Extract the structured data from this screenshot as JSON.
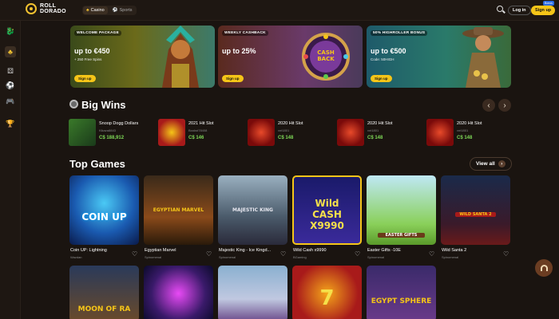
{
  "header": {
    "logo_line1": "ROLL",
    "logo_line2": "DORADO",
    "tabs": [
      {
        "label": "Casino",
        "icon": "casino-icon",
        "active": true
      },
      {
        "label": "Sports",
        "icon": "sports-icon",
        "active": false
      }
    ],
    "login_label": "Log in",
    "signup_label": "Sign up",
    "signup_badge": "Bonus"
  },
  "sidebar": [
    {
      "icon": "dragon-icon"
    },
    {
      "icon": "casino-icon",
      "active": true
    },
    {
      "icon": "dice-icon"
    },
    {
      "icon": "football-icon"
    },
    {
      "icon": "gamepad-icon"
    },
    {
      "icon": "trophy-icon"
    }
  ],
  "banners": [
    {
      "tag": "WELCOME PACKAGE",
      "title": "up to €450",
      "sub": "+ 250 Free Spins",
      "cta": "Sign up"
    },
    {
      "tag": "WEEKLY CASHBACK",
      "title": "up to 25%",
      "sub": "",
      "cta": "Sign up",
      "art_text": "CASH BACK"
    },
    {
      "tag": "50% HIGHROLLER BONUS",
      "title": "up to €500",
      "sub": "Code: 50HIGH",
      "cta": "Sign up"
    }
  ],
  "big_wins": {
    "title": "Big Wins",
    "items": [
      {
        "name": "Snoop Dogg Dollars",
        "user": "Kikaza8843",
        "amount": "C$ 188,912"
      },
      {
        "name": "2021 Hit Slot",
        "user": "Bookst78408",
        "amount": "C$ 146"
      },
      {
        "name": "2020 Hit Slot",
        "user": "vnt1801",
        "amount": "C$ 148"
      },
      {
        "name": "2020 Hit Slot",
        "user": "vnt1801",
        "amount": "C$ 148"
      },
      {
        "name": "2020 Hit Slot",
        "user": "vnt1801",
        "amount": "C$ 148"
      }
    ]
  },
  "top_games": {
    "title": "Top Games",
    "view_all": "View all",
    "items": [
      {
        "name": "Coin UP: Lightning",
        "provider": "Wazdan",
        "art": "COIN UP"
      },
      {
        "name": "Egyptian Marvel",
        "provider": "Spinomenal",
        "art": "EGYPTIAN MARVEL"
      },
      {
        "name": "Majestic King - Ice Kingd...",
        "provider": "Spinomenal",
        "art": "MAJESTIC KING"
      },
      {
        "name": "Wild Cash x9990",
        "provider": "BGaming",
        "art": "Wild CASH X9990"
      },
      {
        "name": "Easter Gifts -10E",
        "provider": "Spinomenal",
        "art": "EASTER GIFTS"
      },
      {
        "name": "Wild Santa 2",
        "provider": "Spinomenal",
        "art": "WILD SANTA 2"
      }
    ],
    "row2": [
      {
        "art": "MOON OF RA"
      },
      {
        "art": ""
      },
      {
        "art": ""
      },
      {
        "art": "7"
      },
      {
        "art": "EGYPT SPHERE"
      }
    ]
  }
}
